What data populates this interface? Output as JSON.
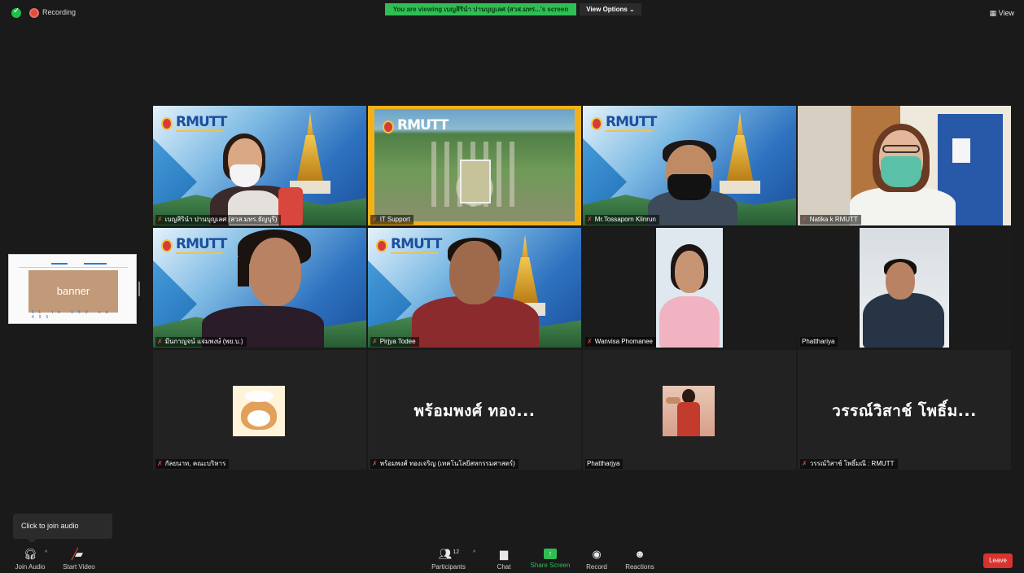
{
  "status": {
    "recording_label": "Recording",
    "viewing_banner": "You are viewing เบญสิรินำ ปานบุญเลศ (สวส.มทร...'s screen",
    "view_options_label": "View Options ⌄",
    "view_label": "View"
  },
  "shared_screen": {
    "banner_text": "banner",
    "footer_text": "11 to 150 ea 495"
  },
  "participants": [
    {
      "name": "เบญสิรินำ ปานบุญเลศ (สวส.มทร.ธัญบุรี)",
      "muted": true,
      "active": true
    },
    {
      "name": "IT Support",
      "muted": true
    },
    {
      "name": "Mr.Tossaporn Klinrun",
      "muted": true
    },
    {
      "name": "Natika k RMUTT",
      "muted": true
    },
    {
      "name": "มีนกาญจน์ แจ่มพงษ์ (พย.บ.)",
      "muted": true
    },
    {
      "name": "Pirjya Todee",
      "muted": true
    },
    {
      "name": "Wanvisa Phomanee",
      "muted": true
    },
    {
      "name": "Phatthariya",
      "muted": false
    },
    {
      "name": "กัลยนาท, คณะบริหาร",
      "muted": true
    },
    {
      "name": "พร้อมพงศ์ ทองเจริญ (เทคโนโลยีสหกรรมศาสตร์)",
      "muted": true,
      "avatar_text": "พร้อมพงศ์ ทอง..."
    },
    {
      "name": "Phattharjya",
      "muted": false
    },
    {
      "name": "วรรณ์วิสาช์ โพธิ์มณี : RMUTT",
      "muted": true,
      "avatar_text": "วรรณ์วิสาช์ โพธิ์ม..."
    }
  ],
  "logo_text": "RMUTT",
  "tooltip": "Click to join audio",
  "toolbar": {
    "join_audio": "Join Audio",
    "start_video": "Start Video",
    "participants": "Participants",
    "participants_count": "12",
    "chat": "Chat",
    "share_screen": "Share Screen",
    "record": "Record",
    "reactions": "Reactions",
    "leave": "Leave"
  },
  "colors": {
    "accent_green": "#2fbe54",
    "leave_red": "#d8332f",
    "active_border": "#c9d86b"
  }
}
